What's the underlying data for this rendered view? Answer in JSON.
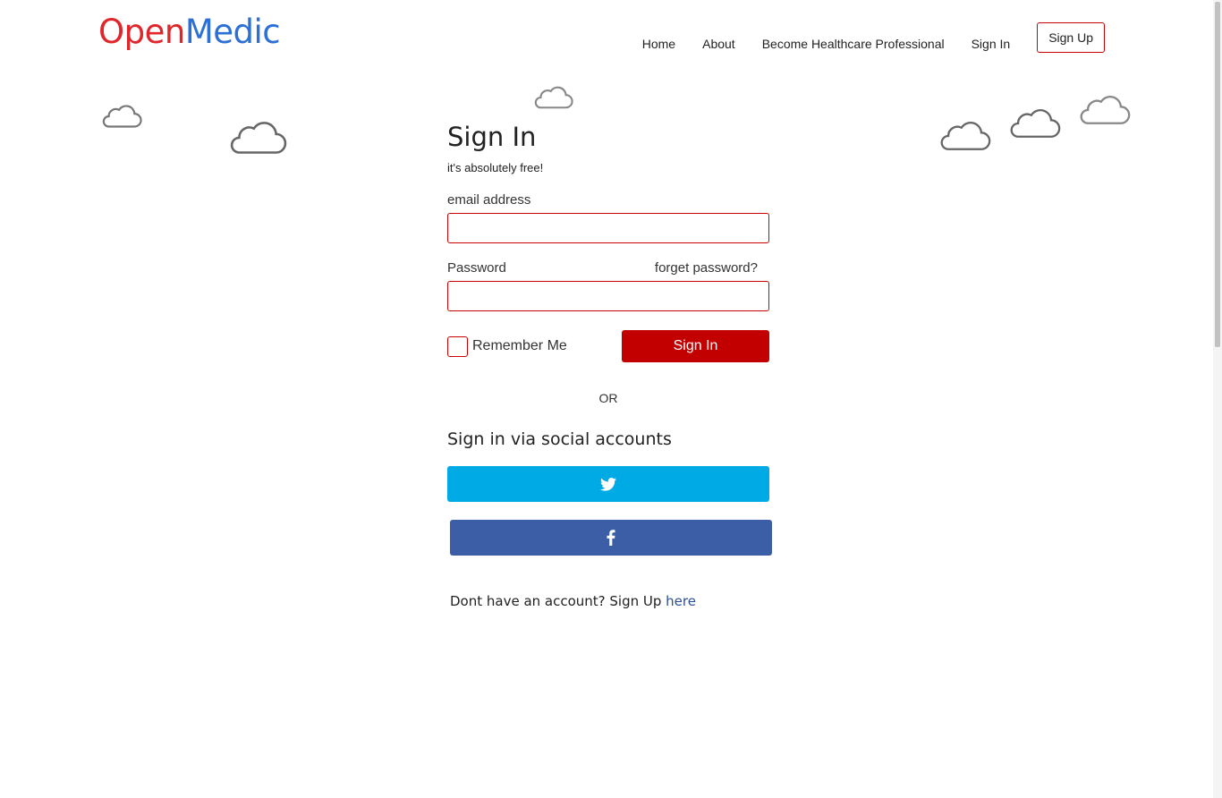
{
  "brand": {
    "part1": "Open",
    "part2": "Medic",
    "color1": "#e0262a",
    "color2": "#2c6fd6"
  },
  "nav": {
    "links": [
      "Home",
      "About",
      "Become Healthcare Professional",
      "Sign In"
    ],
    "signup": "Sign Up"
  },
  "form": {
    "title": "Sign In",
    "subtitle": "it's absolutely free!",
    "email_label": "email address",
    "email_value": "",
    "password_label": "Password",
    "password_value": "",
    "forget_label": "forget password?",
    "remember_label": "Remember Me",
    "remember_checked": false,
    "submit_label": "Sign In",
    "accent": "#c30000"
  },
  "divider": "OR",
  "social": {
    "title": "Sign in via social accounts",
    "twitter_icon": "twitter-icon",
    "twitter_color": "#00aae4",
    "facebook_icon": "facebook-icon",
    "facebook_color": "#3b5ea6"
  },
  "signup_prompt": {
    "text": "Dont have an account? Sign Up ",
    "link": "here"
  }
}
